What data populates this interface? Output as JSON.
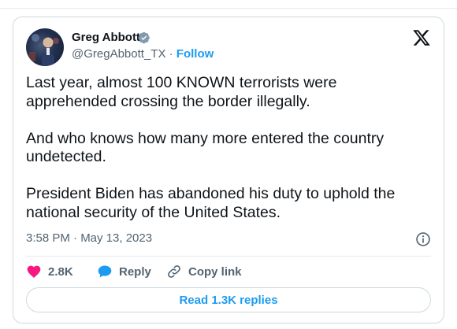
{
  "author": {
    "name": "Greg Abbott",
    "handle": "@GregAbbott_TX",
    "separator": "·",
    "follow_label": "Follow",
    "verified": true,
    "verified_icon": "verified-badge-icon",
    "verified_color": "#829aab"
  },
  "platform": {
    "logo_icon": "x-logo-icon"
  },
  "tweet": {
    "paragraphs": [
      "Last year, almost 100 KNOWN terrorists were apprehended crossing the border illegally.",
      "And who knows how many more entered the country undetected.",
      "President Biden has abandoned his duty to uphold the national security of the United States."
    ],
    "timestamp": "3:58 PM · May 13, 2023",
    "info_icon": "info-icon"
  },
  "actions": {
    "like_count": "2.8K",
    "like_icon": "heart-icon",
    "like_color": "#f91880",
    "reply_label": "Reply",
    "reply_icon": "speech-bubble-icon",
    "reply_color": "#1d9bf0",
    "copy_label": "Copy link",
    "copy_icon": "link-icon"
  },
  "replies_button": {
    "label": "Read 1.3K replies"
  },
  "colors": {
    "accent": "#1d9bf0",
    "text_primary": "#0f1419",
    "text_secondary": "#536471",
    "border": "#cfd9de"
  }
}
